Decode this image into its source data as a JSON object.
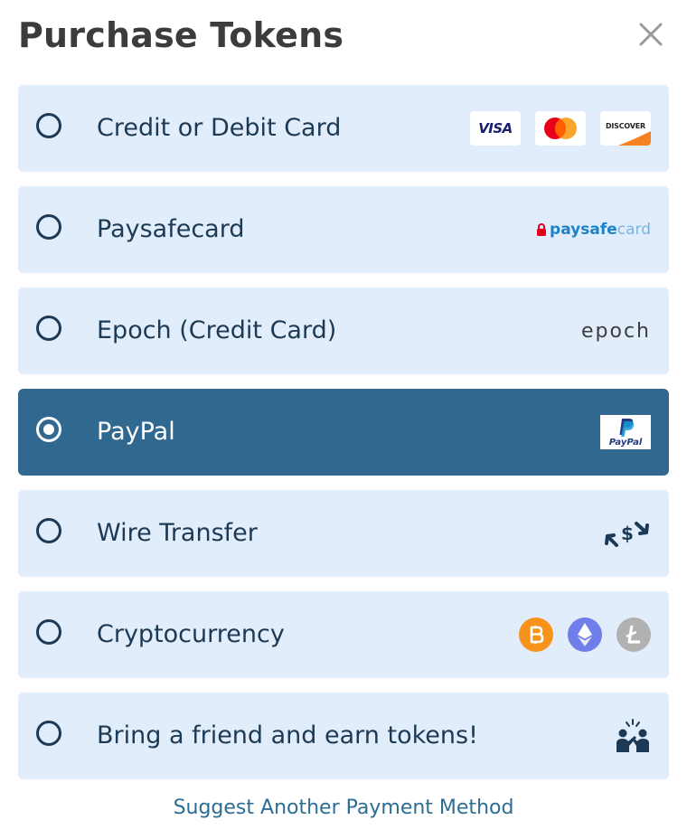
{
  "dialog": {
    "title": "Purchase Tokens",
    "close_icon": "close-icon"
  },
  "options": [
    {
      "label": "Credit or Debit Card",
      "selected": false,
      "logos": [
        "visa-logo",
        "mastercard-logo",
        "discover-logo"
      ],
      "logo_text": {
        "visa": "VISA",
        "discover": "DISCOVER"
      }
    },
    {
      "label": "Paysafecard",
      "selected": false,
      "logos": [
        "paysafecard-logo"
      ],
      "logo_text": {
        "a": "paysafe",
        "b": "card"
      }
    },
    {
      "label": "Epoch (Credit Card)",
      "selected": false,
      "logos": [
        "epoch-logo"
      ],
      "logo_text": {
        "epoch": "epoch"
      }
    },
    {
      "label": "PayPal",
      "selected": true,
      "logos": [
        "paypal-logo"
      ],
      "logo_text": {
        "paypal": "PayPal"
      }
    },
    {
      "label": "Wire Transfer",
      "selected": false,
      "logos": [
        "wire-transfer-icon"
      ]
    },
    {
      "label": "Cryptocurrency",
      "selected": false,
      "logos": [
        "bitcoin-icon",
        "ethereum-icon",
        "litecoin-icon"
      ]
    },
    {
      "label": "Bring a friend and earn tokens!",
      "selected": false,
      "logos": [
        "referral-friends-icon"
      ]
    }
  ],
  "footer": {
    "suggest_link": "Suggest Another Payment Method"
  },
  "colors": {
    "option_bg": "#e1edfa",
    "selected_bg": "#30688f",
    "text_dark": "#1c3a55",
    "link": "#2d6d93",
    "title": "#3c3c3c"
  }
}
